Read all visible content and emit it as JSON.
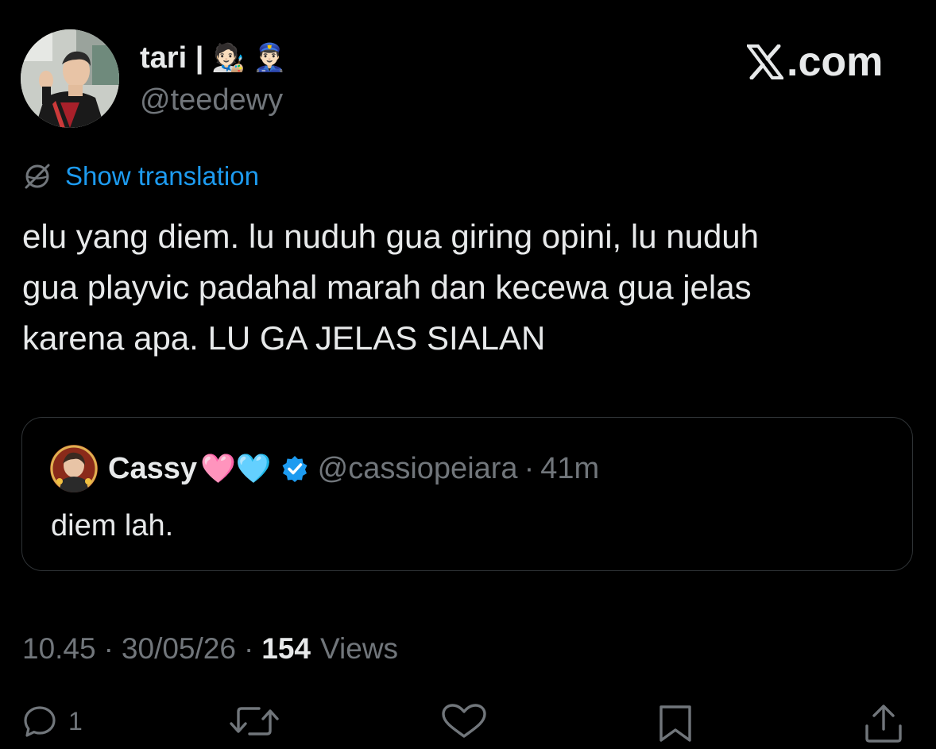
{
  "author": {
    "display_name": "tari |",
    "name_emojis": "🧑🏻‍🎨 👮🏻‍♂️",
    "handle": "@teedewy"
  },
  "brand": {
    "label": ".com",
    "logo_icon": "x-logo-icon"
  },
  "translation": {
    "icon": "globe-icon",
    "label": "Show translation"
  },
  "tweet": {
    "text": "elu yang diem. lu nuduh gua giring opini, lu nuduh\ngua playvic padahal marah dan kecewa gua jelas\nkarena apa. LU GA JELAS SIALAN"
  },
  "quote": {
    "name": "Cassy",
    "name_emojis": "🩷🩵",
    "verified_icon": "verified-badge-icon",
    "handle": "@cassiopeiara",
    "separator": "·",
    "time": "41m",
    "text": "diem lah."
  },
  "meta": {
    "time": "10.45",
    "separator": "·",
    "date": "30/05/26",
    "views_count": "154",
    "views_label": "Views"
  },
  "actions": {
    "reply_count": "1",
    "reply_icon": "reply-icon",
    "retweet_icon": "retweet-icon",
    "like_icon": "heart-icon",
    "bookmark_icon": "bookmark-icon",
    "share_icon": "share-icon"
  },
  "colors": {
    "background": "#000000",
    "text": "#e7e9ea",
    "secondary": "#71767b",
    "link": "#1d9bf0",
    "border": "#2f3336",
    "verified": "#1d9bf0"
  }
}
